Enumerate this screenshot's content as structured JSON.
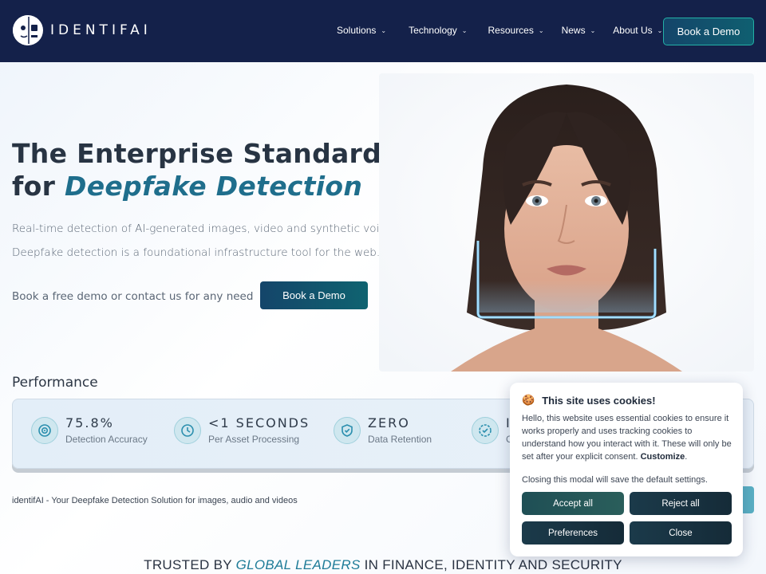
{
  "nav": {
    "brand": "IDENTIFAI",
    "links": [
      {
        "label": "Solutions"
      },
      {
        "label": "Technology"
      },
      {
        "label": "Resources"
      },
      {
        "label": "News"
      },
      {
        "label": "About Us"
      }
    ],
    "cta": "Book a Demo",
    "icons": {
      "dropdown": "chevron-down-icon",
      "logo": "robot-face-logo"
    }
  },
  "hero": {
    "title_line1": "The Enterprise Standard",
    "title_for": "for",
    "title_accent": "Deepfake Detection",
    "subtitle_1": "Real-time detection of AI-generated images, video and synthetic voice.",
    "subtitle_2": "Deepfake detection is a foundational infrastructure tool for the web.",
    "cta_text": "Book a free demo or contact us for any need",
    "cta_button": "Book a Demo"
  },
  "performance": {
    "heading": "Performance",
    "stats": [
      {
        "value": "75.8%",
        "label": "Detection Accuracy",
        "icon": "target-icon"
      },
      {
        "value": "<1 SECONDS",
        "label": "Per Asset Processing",
        "icon": "clock-icon"
      },
      {
        "value": "ZERO",
        "label": "Data Retention",
        "icon": "shield-icon"
      },
      {
        "value": "I",
        "label": "C",
        "icon": "badge-check-icon"
      }
    ]
  },
  "tagline": "identifAI - Your Deepfake Detection Solution for images, audio and videos",
  "trusted": {
    "prefix": "TRUSTED BY",
    "accent": "GLOBAL LEADERS",
    "suffix": "IN FINANCE, IDENTITY AND SECURITY"
  },
  "cookie": {
    "icon": "🍪",
    "title": "This site uses cookies!",
    "body": "Hello, this website uses essential cookies to ensure it works properly and uses tracking cookies to understand how you interact with it. These will only be set after your explicit consent.",
    "customize": "Customize",
    "period": ".",
    "note": "Closing this modal will save the default settings.",
    "buttons": {
      "accept": "Accept all",
      "reject": "Reject all",
      "preferences": "Preferences",
      "close": "Close"
    }
  },
  "colors": {
    "nav_bg": "#14214a",
    "accent": "#1f6e8c",
    "button_teal": "#0f5f70"
  }
}
